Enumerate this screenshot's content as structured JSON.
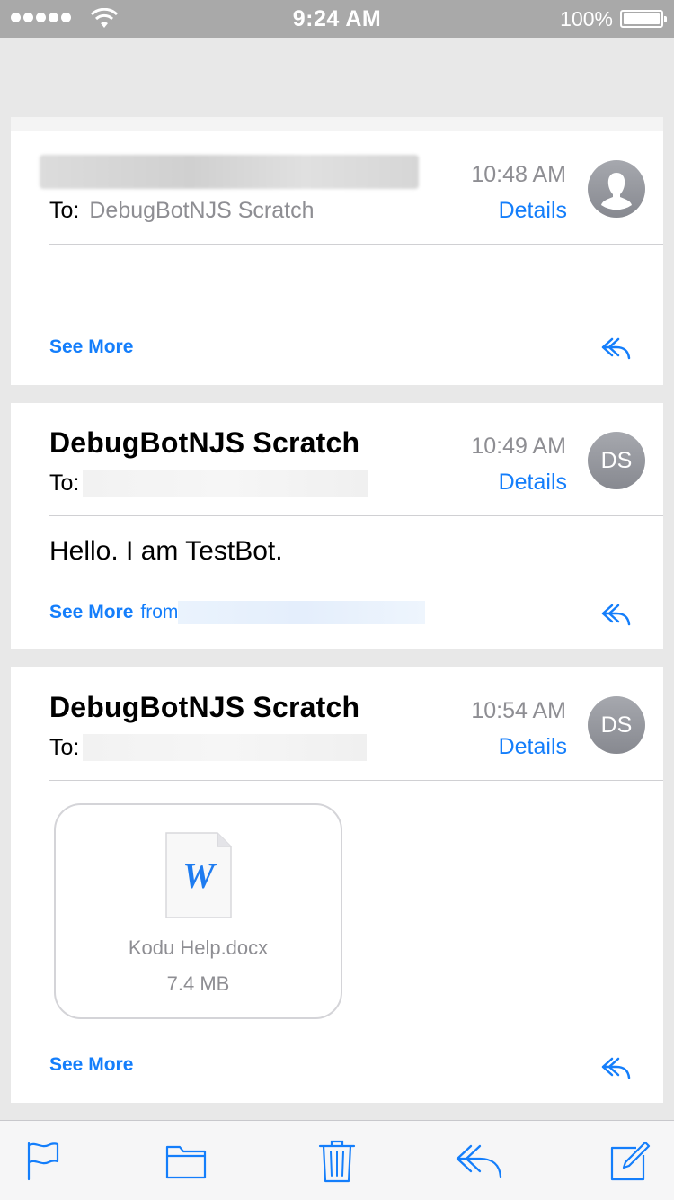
{
  "status_bar": {
    "time": "9:24 AM",
    "battery": "100%"
  },
  "messages": [
    {
      "sender": "",
      "to_label": "To:",
      "to_name": "DebugBotNJS Scratch",
      "time": "10:48 AM",
      "details_label": "Details",
      "avatar_initials": "",
      "body": "",
      "see_more": "See More"
    },
    {
      "sender": "DebugBotNJS Scratch",
      "to_label": "To:",
      "to_name": "",
      "time": "10:49 AM",
      "details_label": "Details",
      "avatar_initials": "DS",
      "body": "Hello. I am TestBot.",
      "see_more": "See More",
      "see_more_from": "from"
    },
    {
      "sender": "DebugBotNJS Scratch",
      "to_label": "To:",
      "to_name": "",
      "time": "10:54 AM",
      "details_label": "Details",
      "avatar_initials": "DS",
      "attachment": {
        "name": "Kodu Help.docx",
        "size": "7.4 MB",
        "icon": "word-doc-icon",
        "glyph": "W"
      },
      "see_more": "See More"
    }
  ],
  "toolbar": {
    "icons": [
      "flag-icon",
      "folder-icon",
      "trash-icon",
      "reply-icon",
      "compose-icon"
    ]
  },
  "colors": {
    "accent": "#147efb",
    "status_bar": "#a9a9a9",
    "secondary_text": "#8e8e93"
  }
}
